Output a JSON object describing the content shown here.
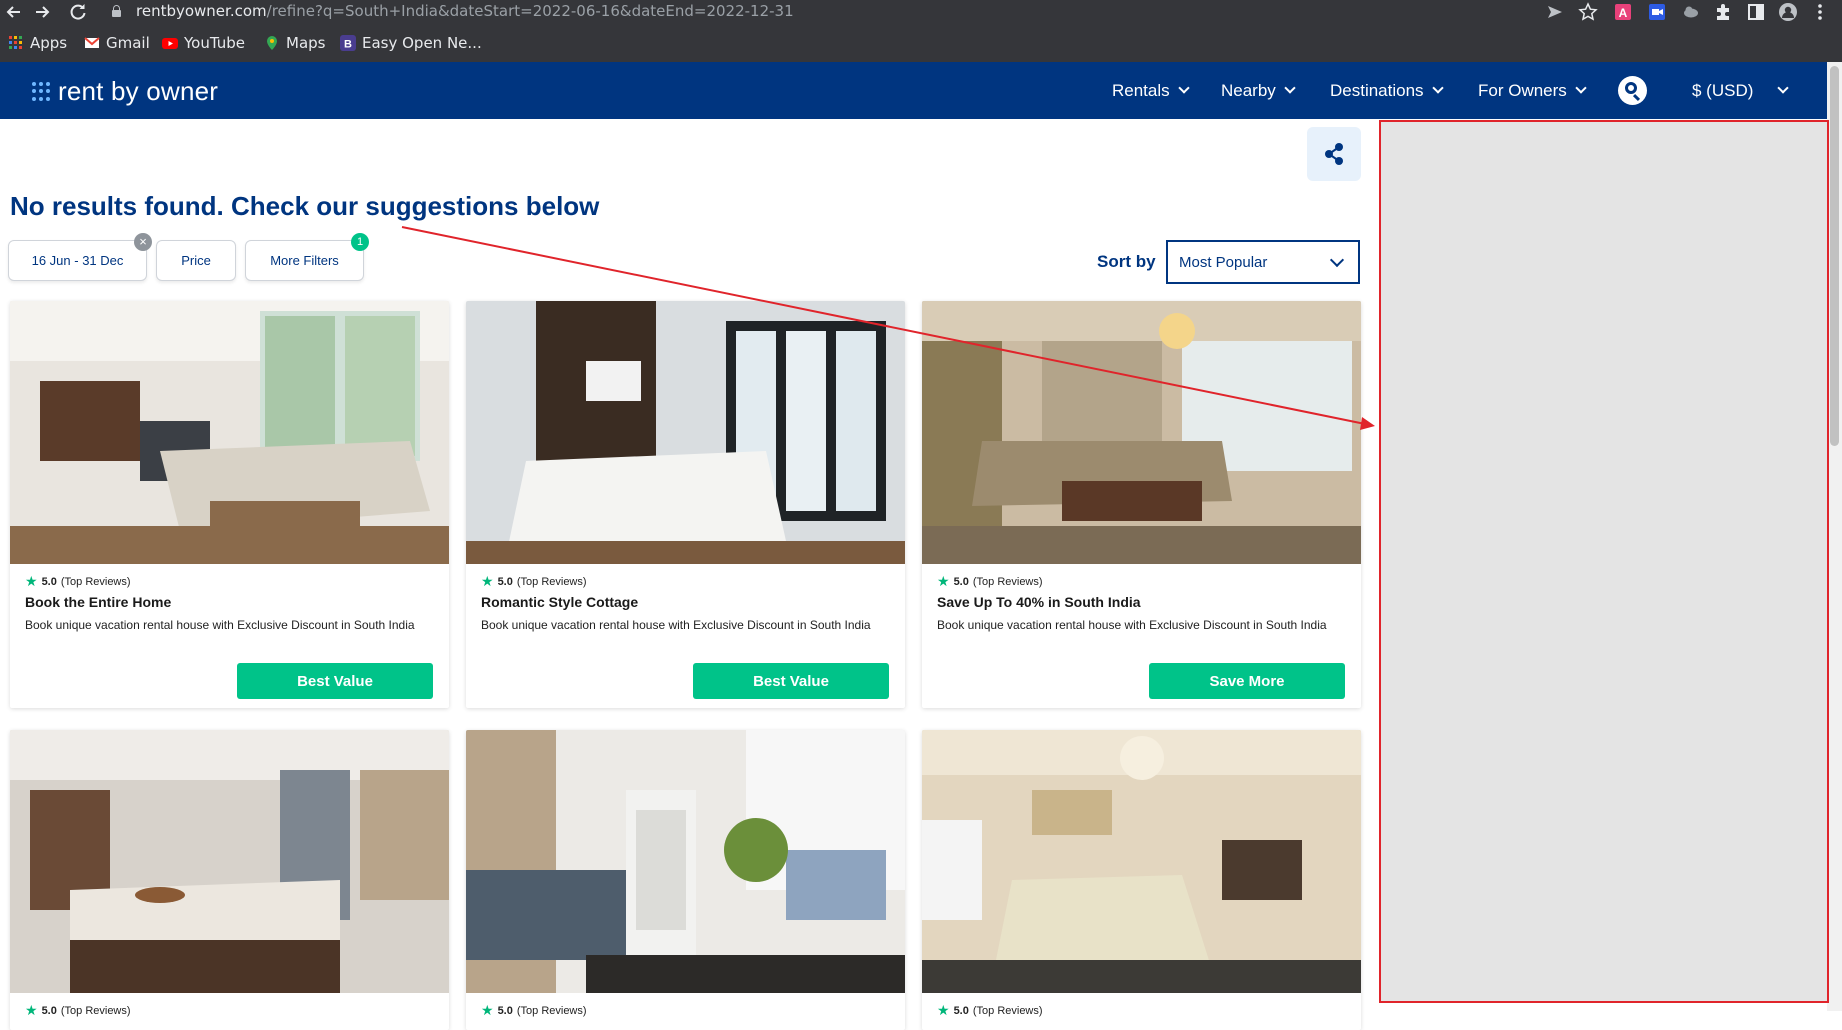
{
  "browser": {
    "url_host": "rentbyowner.com",
    "url_path": "/refine?q=South+India&dateStart=2022-06-16&dateEnd=2022-12-31",
    "bookmarks": [
      {
        "label": "Apps",
        "icon": "apps-grid-icon"
      },
      {
        "label": "Gmail",
        "icon": "gmail-icon"
      },
      {
        "label": "YouTube",
        "icon": "youtube-icon"
      },
      {
        "label": "Maps",
        "icon": "maps-pin-icon"
      },
      {
        "label": "Easy Open Ne...",
        "icon": "bookmark-b-icon"
      }
    ]
  },
  "header": {
    "logo": "rent by owner",
    "nav": [
      {
        "label": "Rentals"
      },
      {
        "label": "Nearby"
      },
      {
        "label": "Destinations"
      },
      {
        "label": "For Owners"
      }
    ],
    "currency": "$ (USD)"
  },
  "main": {
    "heading": "No results found. Check our suggestions below",
    "filters": {
      "dates": "16 Jun - 31 Dec",
      "price": "Price",
      "more": "More Filters",
      "more_badge": "1"
    },
    "sort": {
      "label": "Sort by",
      "value": "Most Popular"
    },
    "cards": [
      {
        "rating": "5.0",
        "reviews": "(Top Reviews)",
        "title": "Book the Entire Home",
        "desc": "Book unique vacation rental house with Exclusive Discount in South India",
        "button": "Best Value"
      },
      {
        "rating": "5.0",
        "reviews": "(Top Reviews)",
        "title": "Romantic Style Cottage",
        "desc": "Book unique vacation rental house with Exclusive Discount in South India",
        "button": "Best Value"
      },
      {
        "rating": "5.0",
        "reviews": "(Top Reviews)",
        "title": "Save Up To 40% in South India",
        "desc": "Book unique vacation rental house with Exclusive Discount in South India",
        "button": "Save More"
      },
      {
        "rating": "5.0",
        "reviews": "(Top Reviews)"
      },
      {
        "rating": "5.0",
        "reviews": "(Top Reviews)"
      },
      {
        "rating": "5.0",
        "reviews": "(Top Reviews)"
      }
    ]
  },
  "colors": {
    "brand_navy": "#003580",
    "accent_green": "#00c389",
    "annotation_red": "#e0242b"
  }
}
